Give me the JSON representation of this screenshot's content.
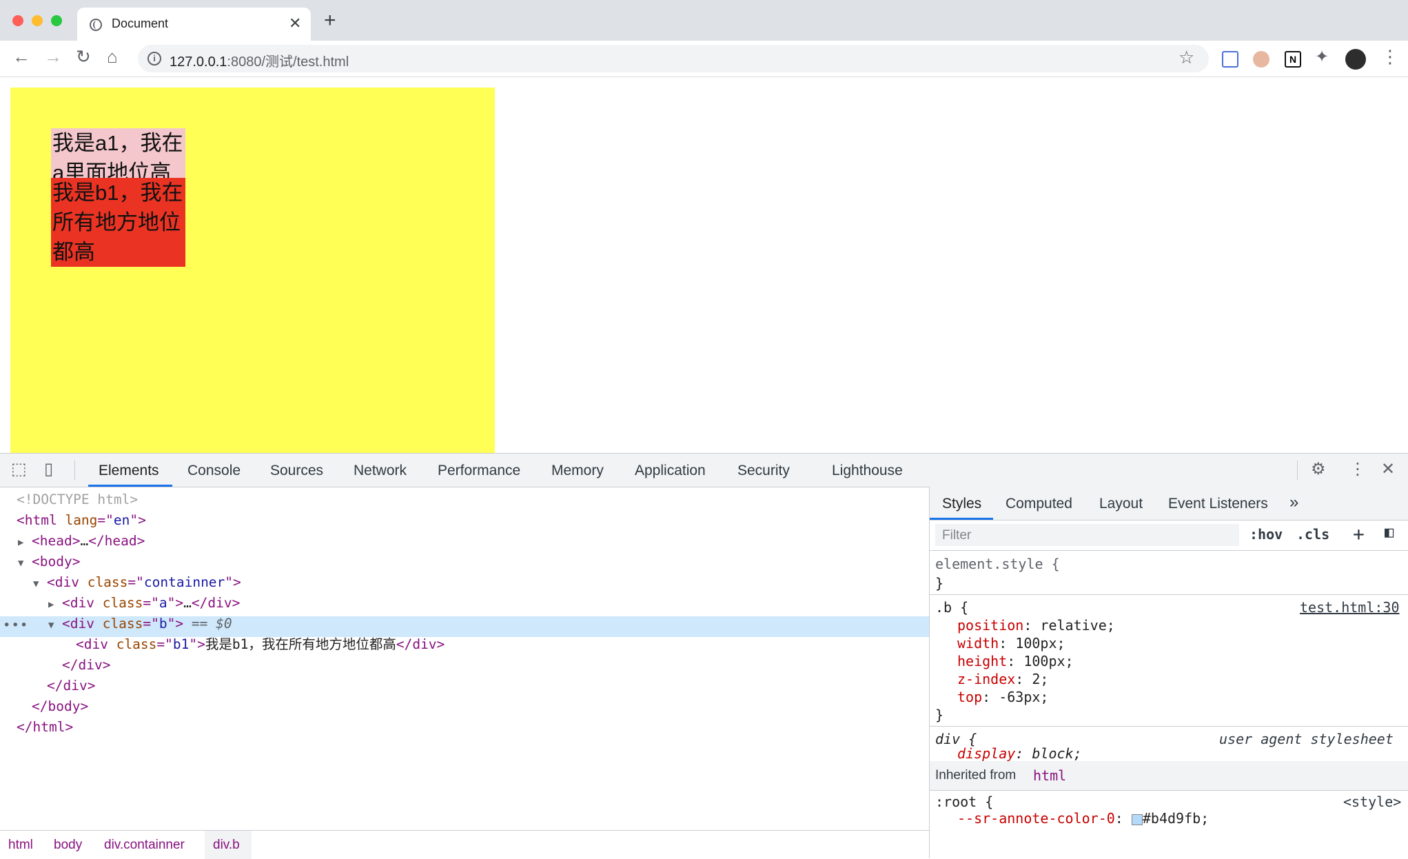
{
  "browser": {
    "tab_title": "Document",
    "url_host": "127.0.0.1",
    "url_rest": ":8080/测试/test.html"
  },
  "page": {
    "box_a_text": "我是a1，我在a里面地位高",
    "box_b_text": "我是b1，我在所有地方地位都高",
    "colors": {
      "container": "#ffff55",
      "a1": "#f4c7cc",
      "b1": "#ea3323"
    }
  },
  "devtools": {
    "tabs": [
      "Elements",
      "Console",
      "Sources",
      "Network",
      "Performance",
      "Memory",
      "Application",
      "Security",
      "Lighthouse"
    ],
    "dom": {
      "doctype": "<!DOCTYPE html>",
      "html_lang_attr": "lang",
      "html_lang_val": "en",
      "class_attr": "class",
      "containner": "containner",
      "a": "a",
      "b": "b",
      "b1": "b1",
      "b1_text": "我是b1，我在所有地方地位都高",
      "ellipsis": "…",
      "selected_marker": " == $0"
    },
    "breadcrumbs": [
      "html",
      "body",
      "div.containner",
      "div.b"
    ],
    "styles_tabs": [
      "Styles",
      "Computed",
      "Layout",
      "Event Listeners"
    ],
    "filter_placeholder": "Filter",
    "filter_buttons": {
      "hov": ":hov",
      "cls": ".cls"
    },
    "rules": {
      "element_style": "element.style {",
      "close": "}",
      "b_selector": ".b {",
      "b_source": "test.html:30",
      "b_props": [
        {
          "name": "position",
          "value": "relative;"
        },
        {
          "name": "width",
          "value": "100px;"
        },
        {
          "name": "height",
          "value": "100px;"
        },
        {
          "name": "z-index",
          "value": "2;"
        },
        {
          "name": "top",
          "value": "-63px;"
        }
      ],
      "div_selector": "div {",
      "div_source": "user agent stylesheet",
      "div_prop": {
        "name": "display",
        "value": "block;"
      },
      "inherited_label": "Inherited from",
      "inherited_tag": "html",
      "root_selector": ":root {",
      "root_source": "<style>",
      "root_prop": {
        "name": "--sr-annote-color-0",
        "value": "#b4d9fb;"
      }
    }
  }
}
